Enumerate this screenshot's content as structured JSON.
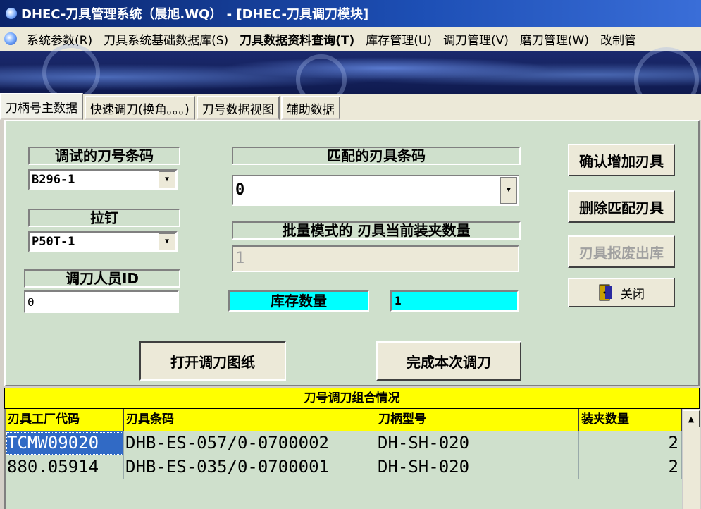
{
  "window": {
    "title": "DHEC-刀具管理系统（晨旭.WQ）  - [DHEC-刀具调刀模块]"
  },
  "menu": {
    "items": [
      "系统参数(R)",
      "刀具系统基础数据库(S)",
      "刀具数据资料查询(T)",
      "库存管理(U)",
      "调刀管理(V)",
      "磨刀管理(W)",
      "改制管"
    ]
  },
  "tabs": [
    "刀柄号主数据",
    "快速调刀(换角。。。)",
    "刀号数据视图",
    "辅助数据"
  ],
  "form": {
    "tool_barcode_label": "调试的刀号条码",
    "tool_barcode_value": "B296-1",
    "pull_stud_label": "拉钉",
    "pull_stud_value": "P50T-1",
    "operator_label": "调刀人员ID",
    "operator_value": "0",
    "match_barcode_label": "匹配的刃具条码",
    "match_barcode_value": "0",
    "batch_label": "批量模式的 刃具当前装夹数量",
    "batch_value": "1",
    "stock_label": "库存数量",
    "stock_value": "1"
  },
  "buttons": {
    "confirm_add": "确认增加刃具",
    "delete_match": "删除匹配刃具",
    "scrap_out": "刃具报废出库",
    "close": "关闭",
    "open_drawing": "打开调刀图纸",
    "finish": "完成本次调刀"
  },
  "grid": {
    "title": "刀号调刀组合情况",
    "columns": [
      "刃具工厂代码",
      "刃具条码",
      "刀柄型号",
      "装夹数量"
    ],
    "rows": [
      [
        "TCMW09020",
        "DHB-ES-057/0-0700002",
        "DH-SH-020",
        "2"
      ],
      [
        "880.05914",
        "DHB-ES-035/0-0700001",
        "DH-SH-020",
        "2"
      ]
    ]
  },
  "colors": {
    "highlight": "#00ffff",
    "grid_header": "#ffff00",
    "panel": "#cfe0cc"
  }
}
